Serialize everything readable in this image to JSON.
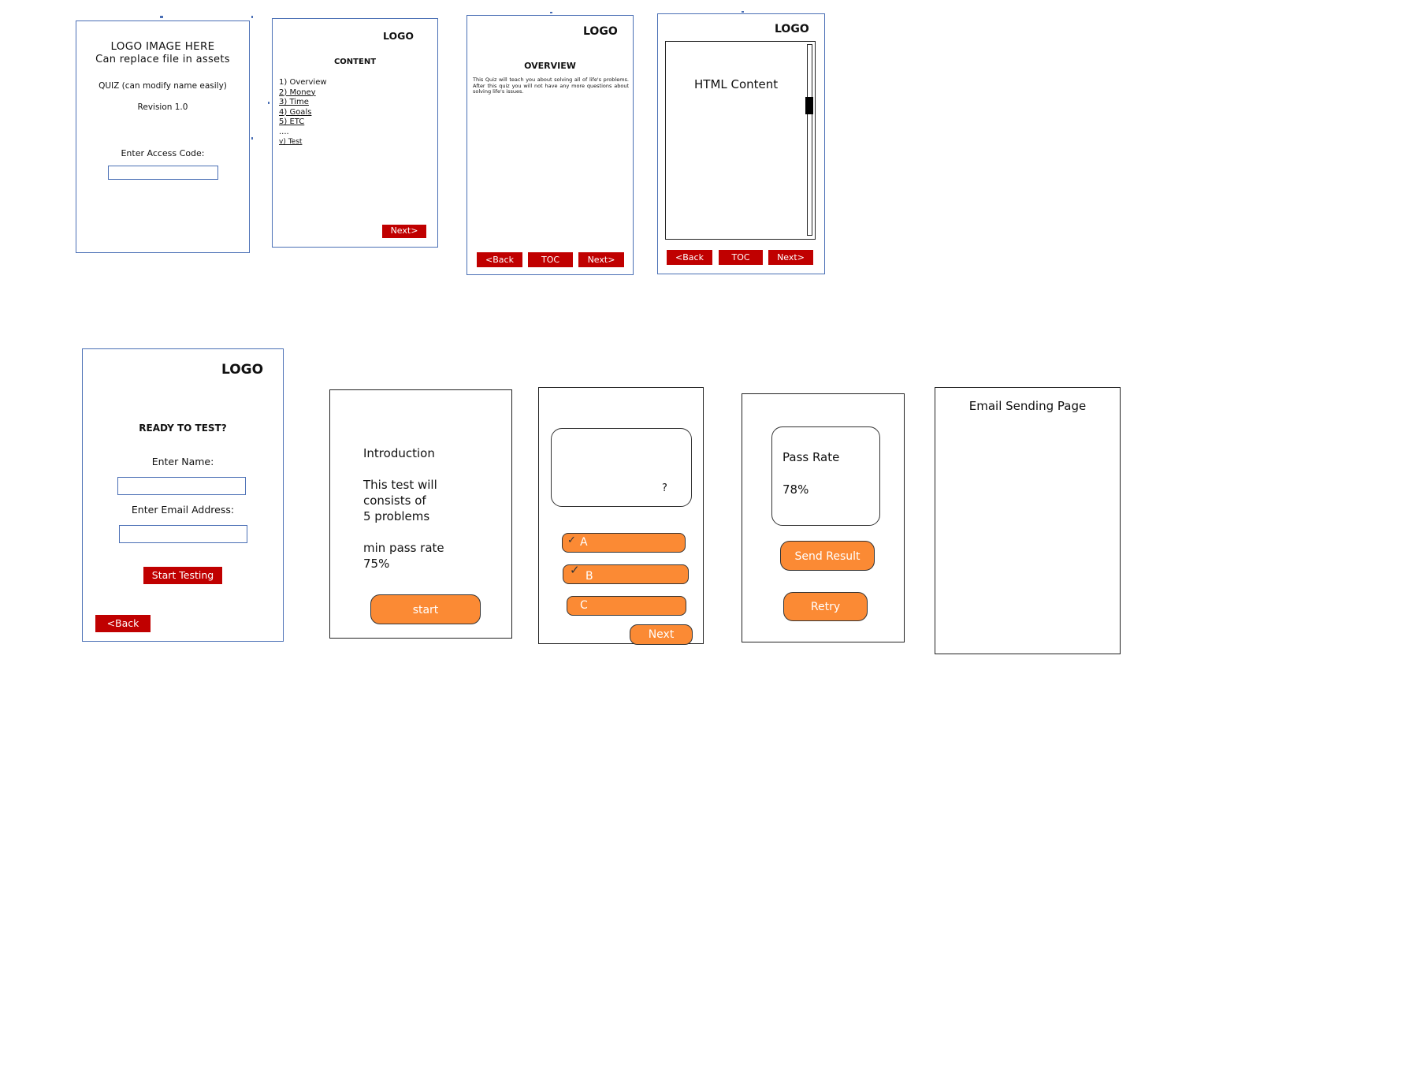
{
  "screen1": {
    "logo_line1": "LOGO IMAGE HERE",
    "logo_line2": "Can replace file in assets",
    "quiz_line": "QUIZ (can modify name easily)",
    "revision": "Revision 1.0",
    "access_label": "Enter Access Code:"
  },
  "screen2": {
    "logo": "LOGO",
    "heading": "CONTENT",
    "items": [
      "1) Overview",
      "2) Money",
      "3) Time",
      "4) Goals",
      "5) ETC",
      "....",
      "v) Test"
    ],
    "next": "Next>"
  },
  "screen3": {
    "logo": "LOGO",
    "heading": "OVERVIEW",
    "body": "This Quiz will teach you about solving all of life's problems. After this quiz you will not have any more questions about solving life's issues.",
    "back": "<Back",
    "toc": "TOC",
    "next": "Next>"
  },
  "screen4": {
    "logo": "LOGO",
    "content": "HTML Content",
    "back": "<Back",
    "toc": "TOC",
    "next": "Next>"
  },
  "screen5": {
    "logo": "LOGO",
    "heading": "READY TO TEST?",
    "name_label": "Enter Name:",
    "email_label": "Enter Email Address:",
    "start": "Start Testing",
    "back": "<Back"
  },
  "screen6": {
    "title": "Introduction",
    "line1": "This test will",
    "line2": "consists of",
    "line3": "5 problems",
    "line4": "min pass rate",
    "line5": "75%",
    "start": "start"
  },
  "screen7": {
    "question_mark": "?",
    "option_a": "A",
    "option_b": "B",
    "option_c": "C",
    "next": "Next"
  },
  "screen8": {
    "pass_label": "Pass Rate",
    "pass_value": "78%",
    "send": "Send Result",
    "retry": "Retry"
  },
  "screen9": {
    "title": "Email Sending Page"
  }
}
